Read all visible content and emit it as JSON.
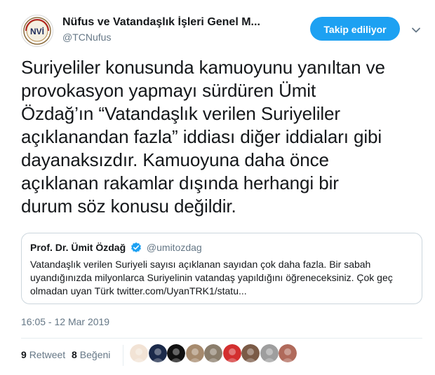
{
  "header": {
    "display_name": "Nüfus ve Vatandaşlık İşleri Genel M...",
    "handle": "@TCNufus",
    "follow_label": "Takip ediliyor",
    "avatar_logo_text": "NVİ"
  },
  "tweet": {
    "lines": [
      "Suriyeliler konusunda kamuoyunu yanıltan ve",
      "provokasyon yapmayı sürdüren Ümit",
      "Özdağ’ın “Vatandaşlık verilen Suriyeliler",
      "açıklanandan fazla” iddiası diğer iddiaları gibi",
      "dayanaksızdır. Kamuoyuna daha önce",
      "açıklanan rakamlar dışında herhangi bir",
      "durum söz konusu değildir."
    ]
  },
  "quote": {
    "name": "Prof. Dr. Ümit Özdağ",
    "handle": "@umitozdag",
    "lines": [
      "Vatandaşlık verilen Suriyeli sayısı açıklanan sayıdan çok daha fazla. Bir sabah",
      "uyandığınızda milyonlarca Suriyelinin vatandaş yapıldığını öğreneceksiniz. Çok geç",
      "olmadan uyan Türk twitter.com/UyanTRK1/statu..."
    ]
  },
  "timestamp": "16:05 - 12 Mar 2019",
  "stats": {
    "retweets_count": "9",
    "retweets_label": "Retweet",
    "likes_count": "8",
    "likes_label": "Beğeni"
  },
  "likers": [
    {
      "name": "liker-avatar-1",
      "color": "#f2e3d5"
    },
    {
      "name": "liker-avatar-2",
      "color": "#1b2a4a"
    },
    {
      "name": "liker-avatar-3",
      "color": "#111111"
    },
    {
      "name": "liker-avatar-4",
      "color": "#a68a6d"
    },
    {
      "name": "liker-avatar-5",
      "color": "#8a7d6b"
    },
    {
      "name": "liker-avatar-6",
      "color": "#d32f2f"
    },
    {
      "name": "liker-avatar-7",
      "color": "#7b5b47"
    },
    {
      "name": "liker-avatar-8",
      "color": "#9e9e9e"
    },
    {
      "name": "liker-avatar-9",
      "color": "#b06a5b"
    }
  ],
  "colors": {
    "accent": "#1da1f2",
    "text": "#14171a",
    "secondary_text": "#657786",
    "border": "#ccd6dd"
  },
  "icons": {
    "verified": "verified-badge-icon",
    "caret": "chevron-down-icon"
  }
}
